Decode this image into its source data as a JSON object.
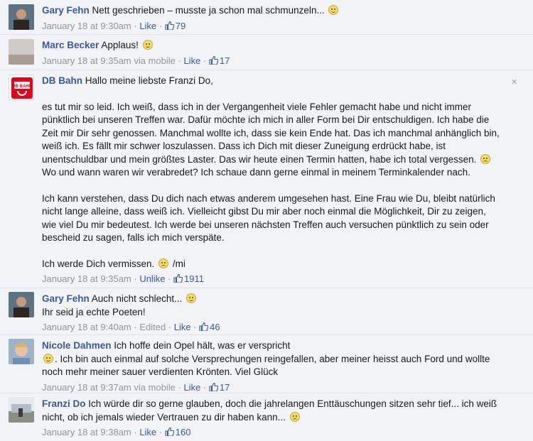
{
  "comments": [
    {
      "author": "Gary Fehn",
      "text": "Nett geschrieben – musste ja schon mal schmunzeln...",
      "emoji": "happy",
      "time": "January 18 at 9:30am",
      "sep": " · ",
      "action": "Like",
      "likes": "79"
    },
    {
      "author": "Marc Becker",
      "text": "Applaus!",
      "emoji": "happy",
      "time": "January 18 at 9:35am via mobile",
      "sep": " · ",
      "action": "Like",
      "likes": "17"
    },
    {
      "author": "DB Bahn",
      "text": "Hallo meine liebste Franzi Do,",
      "p1": "es tut mir so leid. Ich weiß, dass ich in der Vergangenheit viele Fehler gemacht habe und nicht immer pünktlich bei unseren Treffen war. Dafür möchte ich mich in aller Form bei Dir entschuldigen. Ich habe die Zeit mir Dir sehr genossen. Manchmal wollte ich, dass sie kein Ende hat. Das ich manchmal anhänglich bin, weiß ich. Es fällt mir schwer loszulassen. Dass ich Dich mit dieser Zuneigung erdrückt habe, ist unentschuldbar und mein größtes Laster. Das wir heute einen Termin hatten, habe ich total vergessen.",
      "p1b": "Wo und wann waren wir verabredet? Ich schaue dann gerne einmal in meinem Terminkalender nach.",
      "p2": "Ich kann verstehen, dass Du dich nach etwas anderem umgesehen hast. Eine Frau wie Du, bleibt natürlich nicht lange alleine, dass weiß ich. Vielleicht gibst Du mir aber noch einmal die Möglichkeit, Dir zu zeigen, wie viel Du mir bedeutest. Ich werde bei unseren nächsten Treffen auch versuchen pünktlich zu sein oder bescheid zu sagen, falls ich mich verspäte.",
      "p3": "Ich werde Dich vermissen.",
      "p3b": "/mi",
      "time": "January 18 at 9:35am",
      "sep": " · ",
      "action": "Unlike",
      "likes": "1911",
      "logo_text": "DB BAHN",
      "close": "×"
    },
    {
      "author": "Gary Fehn",
      "text": "Auch nicht schlecht...",
      "emoji": "happy",
      "line2": "Ihr seid ja echte Poeten!",
      "time": "January 18 at 9:40am",
      "sep": " · ",
      "edited": "Edited",
      "action": "Like",
      "likes": "46"
    },
    {
      "author": "Nicole Dahmen",
      "text": "Ich hoffe dein Opel hält, was er verspricht",
      "line2": ". Ich bin auch einmal auf solche Versprechungen reingefallen, aber meiner heisst auch Ford und wollte noch mehr meiner sauer verdienten Krönten. Viel Glück",
      "time": "January 18 at 9:37am via mobile",
      "sep": " · ",
      "action": "Like",
      "likes": "17"
    },
    {
      "author": "Franzi Do",
      "text": "Ich würde dir so gerne glauben, doch die jahrelangen Enttäuschungen sitzen sehr tief... ich weiß nicht, ob ich jemals wieder Vertrauen zu dir haben kann...",
      "time": "January 18 at 9:38am",
      "sep": " · ",
      "action": "Like",
      "likes": "160"
    }
  ],
  "colors": {
    "link": "#3b5998",
    "meta": "#90949c",
    "background": "#f2f3f7",
    "db_red": "#e2001a"
  }
}
